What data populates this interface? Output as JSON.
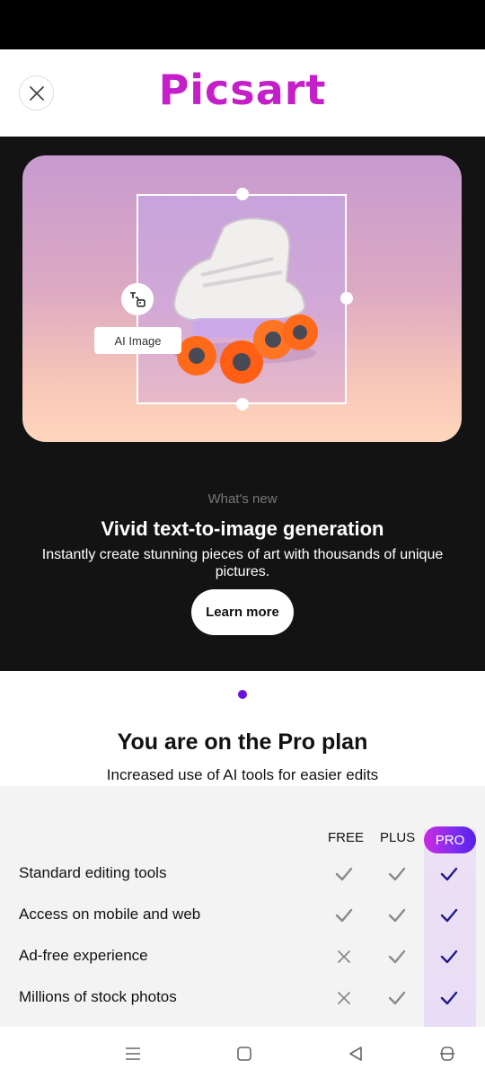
{
  "app": {
    "logo_text": "Picsart",
    "brand_color": "#c41fc8"
  },
  "hero": {
    "chip_label": "AI Image",
    "whats_new": "What's new",
    "title": "Vivid text-to-image generation",
    "description": "Instantly create stunning pieces of art with thousands of unique pictures.",
    "cta_label": "Learn more"
  },
  "carousel": {
    "active_index": 0,
    "dot_color": "#6a11e0"
  },
  "plan": {
    "title": "You are on the Pro plan",
    "subtitle": "Increased use of AI tools for easier edits"
  },
  "comparison": {
    "columns": [
      "FREE",
      "PLUS",
      "PRO"
    ],
    "rows": [
      {
        "label": "Standard editing tools",
        "free": "check",
        "plus": "check",
        "pro": "check"
      },
      {
        "label": "Access on mobile and web",
        "free": "check",
        "plus": "check",
        "pro": "check"
      },
      {
        "label": "Ad-free experience",
        "free": "cross",
        "plus": "check",
        "pro": "check"
      },
      {
        "label": "Millions of stock photos",
        "free": "cross",
        "plus": "check",
        "pro": "check"
      }
    ],
    "pro_accent": "#5a1ee6"
  },
  "icons": {
    "close": "close-icon",
    "ai_badge": "text-to-image-icon",
    "nav_menu": "menu-icon",
    "nav_home": "home-icon",
    "nav_back": "back-icon",
    "nav_assist": "assistant-icon"
  }
}
